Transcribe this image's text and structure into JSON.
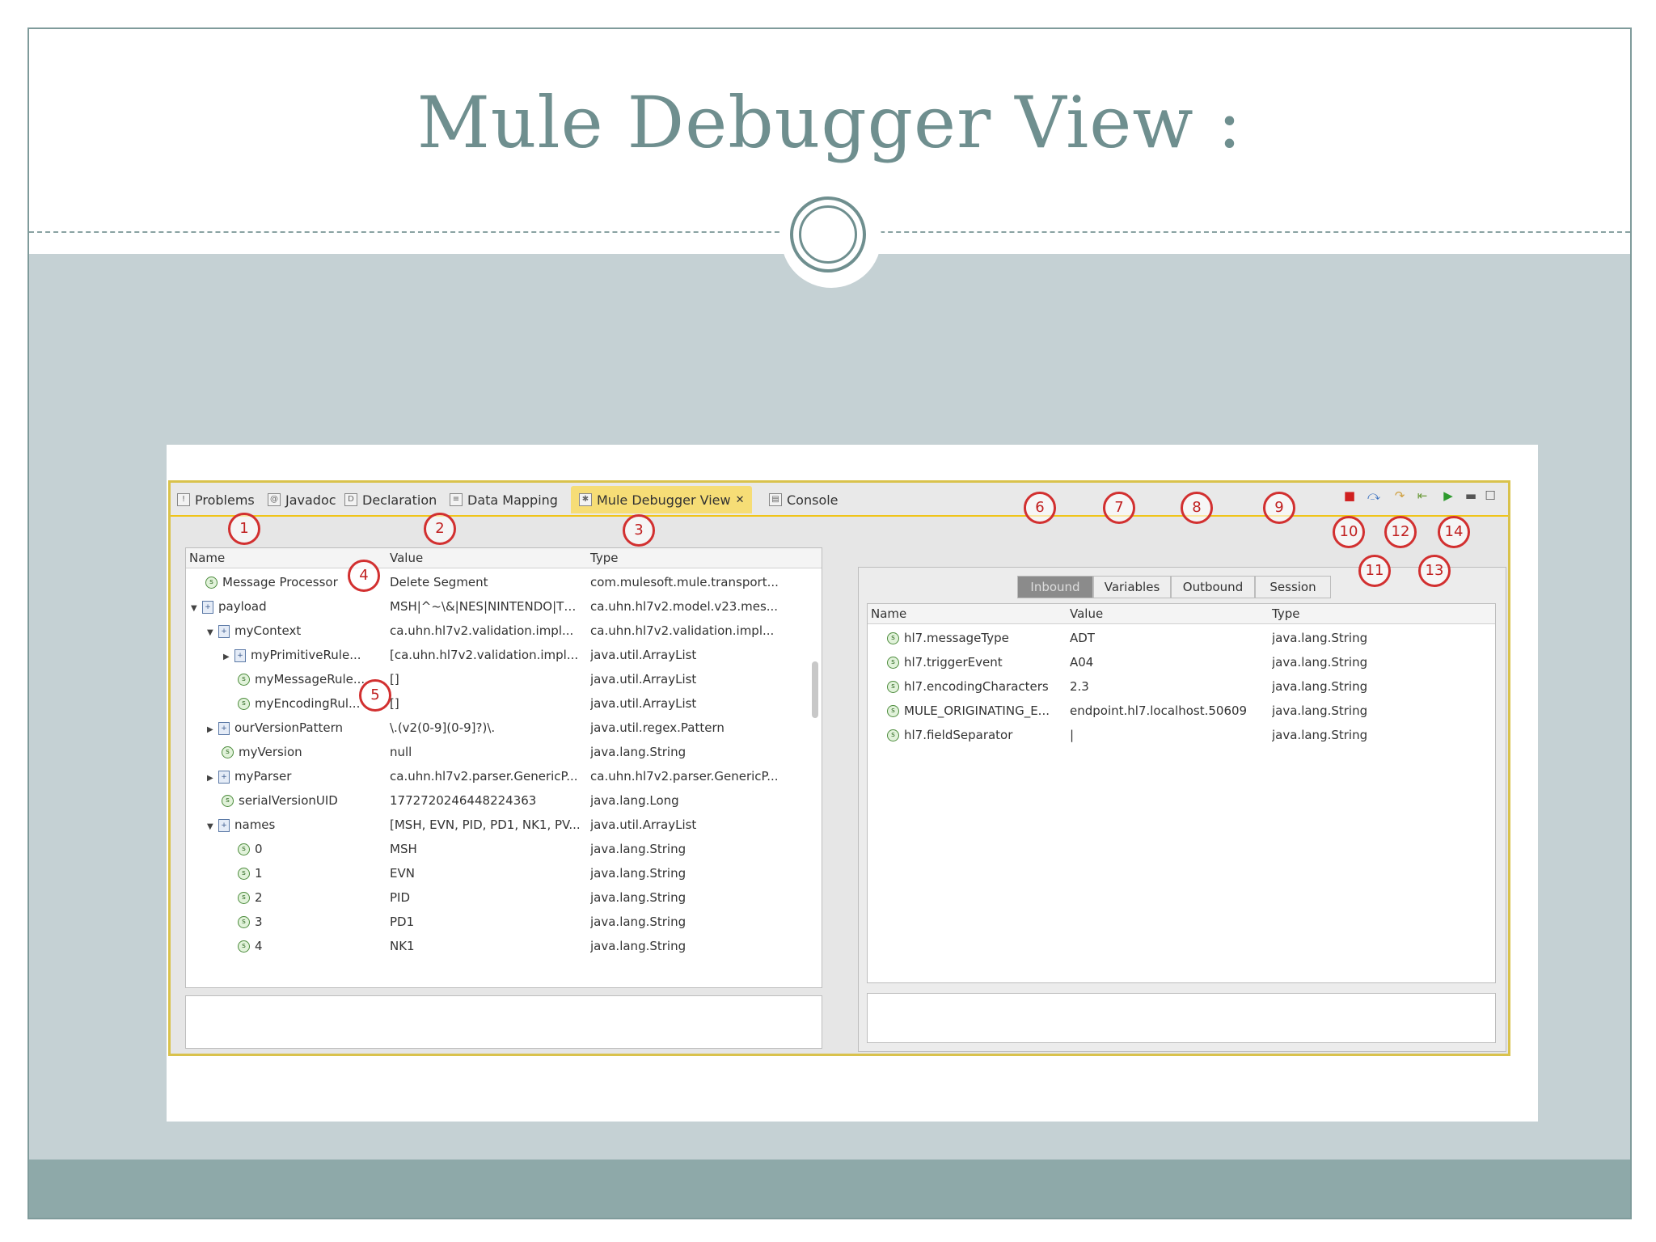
{
  "slide": {
    "title": "Mule Debugger View :"
  },
  "ide": {
    "tabs": [
      {
        "label": "Problems",
        "icon": "problems-icon"
      },
      {
        "label": "Javadoc",
        "icon": "javadoc-icon"
      },
      {
        "label": "Declaration",
        "icon": "declaration-icon"
      },
      {
        "label": "Data Mapping",
        "icon": "data-mapping-icon"
      },
      {
        "label": "Mule Debugger View",
        "icon": "bug-icon",
        "active": true
      },
      {
        "label": "Console",
        "icon": "console-icon"
      }
    ],
    "left_table": {
      "columns": [
        "Name",
        "Value",
        "Type"
      ],
      "rows": [
        {
          "name": "Message Processor",
          "value": "Delete Segment",
          "type": "com.mulesoft.mule.transport..."
        },
        {
          "name": "payload",
          "value": "MSH|^~\\&|NES|NINTENDO|TE...",
          "type": "ca.uhn.hl7v2.model.v23.mes..."
        },
        {
          "name": "myContext",
          "value": "ca.uhn.hl7v2.validation.impl...",
          "type": "ca.uhn.hl7v2.validation.impl..."
        },
        {
          "name": "myPrimitiveRule...",
          "value": "[ca.uhn.hl7v2.validation.impl...",
          "type": "java.util.ArrayList"
        },
        {
          "name": "myMessageRule...",
          "value": "[]",
          "type": "java.util.ArrayList"
        },
        {
          "name": "myEncodingRul...",
          "value": "[]",
          "type": "java.util.ArrayList"
        },
        {
          "name": "ourVersionPattern",
          "value": "\\.(v2(0-9](0-9]?)\\.",
          "type": "java.util.regex.Pattern"
        },
        {
          "name": "myVersion",
          "value": "null",
          "type": "java.lang.String"
        },
        {
          "name": "myParser",
          "value": "ca.uhn.hl7v2.parser.GenericP...",
          "type": "ca.uhn.hl7v2.parser.GenericP..."
        },
        {
          "name": "serialVersionUID",
          "value": "1772720246448224363",
          "type": "java.lang.Long"
        },
        {
          "name": "names",
          "value": "[MSH, EVN, PID, PD1, NK1, PV...",
          "type": "java.util.ArrayList"
        },
        {
          "name": "0",
          "value": "MSH",
          "type": "java.lang.String"
        },
        {
          "name": "1",
          "value": "EVN",
          "type": "java.lang.String"
        },
        {
          "name": "2",
          "value": "PID",
          "type": "java.lang.String"
        },
        {
          "name": "3",
          "value": "PD1",
          "type": "java.lang.String"
        },
        {
          "name": "4",
          "value": "NK1",
          "type": "java.lang.String"
        }
      ]
    },
    "right_tabs": [
      "Inbound",
      "Variables",
      "Outbound",
      "Session"
    ],
    "right_table": {
      "columns": [
        "Name",
        "Value",
        "Type"
      ],
      "rows": [
        {
          "name": "hl7.messageType",
          "value": "ADT",
          "type": "java.lang.String"
        },
        {
          "name": "hl7.triggerEvent",
          "value": "A04",
          "type": "java.lang.String"
        },
        {
          "name": "hl7.encodingCharacters",
          "value": "2.3",
          "type": "java.lang.String"
        },
        {
          "name": "MULE_ORIGINATING_E...",
          "value": "endpoint.hl7.localhost.50609",
          "type": "java.lang.String"
        },
        {
          "name": "hl7.fieldSeparator",
          "value": "|",
          "type": "java.lang.String"
        }
      ]
    },
    "callouts": [
      "1",
      "2",
      "3",
      "4",
      "5",
      "6",
      "7",
      "8",
      "9",
      "10",
      "11",
      "12",
      "13",
      "14"
    ],
    "colors": {
      "active_tab": "#f6dd76",
      "frame": "#d9c24c",
      "callout": "#d23030",
      "slide_accent": "#6f8f8f"
    }
  }
}
